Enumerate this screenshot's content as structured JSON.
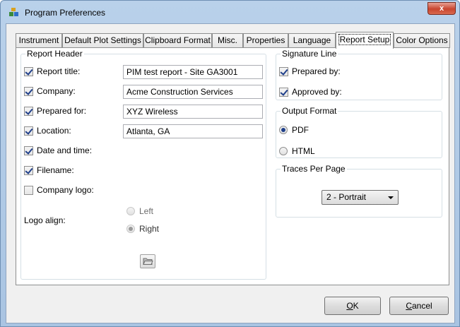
{
  "window": {
    "title": "Program Preferences",
    "close_label": "x"
  },
  "tabs": [
    {
      "label": "Instrument"
    },
    {
      "label": "Default Plot Settings"
    },
    {
      "label": "Clipboard Format"
    },
    {
      "label": "Misc."
    },
    {
      "label": "Properties"
    },
    {
      "label": "Language"
    },
    {
      "label": "Report Setup",
      "active": true
    },
    {
      "label": "Color Options"
    }
  ],
  "report_header": {
    "legend": "Report Header",
    "fields": [
      {
        "label": "Report title:",
        "checked": true,
        "value": "PIM test report - Site GA3001"
      },
      {
        "label": "Company:",
        "checked": true,
        "value": "Acme Construction Services"
      },
      {
        "label": "Prepared for:",
        "checked": true,
        "value": "XYZ Wireless"
      },
      {
        "label": "Location:",
        "checked": true,
        "value": "Atlanta, GA"
      },
      {
        "label": "Date and time:",
        "checked": true
      },
      {
        "label": "Filename:",
        "checked": true
      },
      {
        "label": "Company logo:",
        "checked": false
      }
    ],
    "logo_align": {
      "label": "Logo align:",
      "options": [
        {
          "label": "Left",
          "selected": false
        },
        {
          "label": "Right",
          "selected": true
        }
      ]
    }
  },
  "signature_line": {
    "legend": "Signature Line",
    "items": [
      {
        "label": "Prepared by:",
        "checked": true
      },
      {
        "label": "Approved by:",
        "checked": true
      }
    ]
  },
  "output_format": {
    "legend": "Output Format",
    "options": [
      {
        "label": "PDF",
        "selected": true
      },
      {
        "label": "HTML",
        "selected": false
      }
    ]
  },
  "traces_per_page": {
    "legend": "Traces Per Page",
    "selected": "2 - Portrait"
  },
  "buttons": {
    "ok_rest": "K",
    "ok_mnemonic": "O",
    "cancel_mnemonic": "C",
    "cancel_rest": "ancel"
  }
}
